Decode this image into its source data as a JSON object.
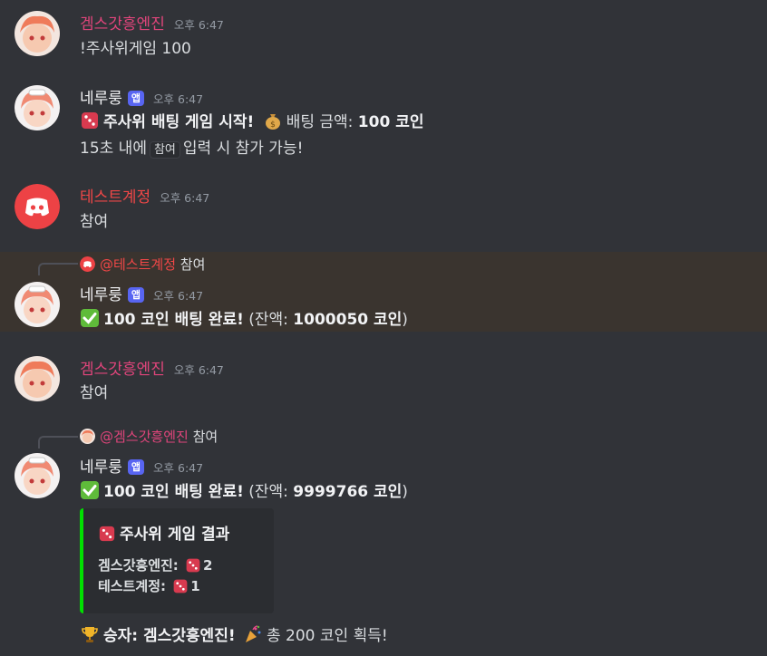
{
  "colors": {
    "background": "#313338",
    "gemsu_name": "#e0457b",
    "test_name": "#f04747",
    "bot_name": "#f2f3f5",
    "app_badge": "#5865f2",
    "embed_bar": "#00e000",
    "highlight": "#3a342f"
  },
  "messages": [
    {
      "author": "겜스갓흥엔진",
      "time": "오후 6:47",
      "text": "!주사위게임 100"
    },
    {
      "author": "네루룽",
      "badge": "앱",
      "time": "오후 6:47",
      "line1_bold": "주사위 배팅 게임 시작!",
      "line1_pre": "배팅 금액: ",
      "line1_amount": "100 코인",
      "line2_a": "15초 내에",
      "line2_code": "참여",
      "line2_b": "입력 시 참가 가능!"
    },
    {
      "author": "테스트계정",
      "time": "오후 6:47",
      "text": "참여"
    },
    {
      "reply_to": "@테스트계정",
      "reply_text": "참여",
      "author": "네루룽",
      "badge": "앱",
      "time": "오후 6:47",
      "bold": "100 코인 배팅 완료!",
      "pre": " (잔액: ",
      "balance": "1000050 코인",
      "post": ")"
    },
    {
      "author": "겜스갓흥엔진",
      "time": "오후 6:47",
      "text": "참여"
    },
    {
      "reply_to": "@겜스갓흥엔진",
      "reply_text": "참여",
      "author": "네루룽",
      "badge": "앱",
      "time": "오후 6:47",
      "bold": "100 코인 배팅 완료!",
      "pre": " (잔액: ",
      "balance": "9999766 코인",
      "post": ")"
    }
  ],
  "embed": {
    "title": "주사위 게임 결과",
    "rows": [
      {
        "name": "겜스갓흥엔진:",
        "value": "2"
      },
      {
        "name": "테스트계정:",
        "value": "1"
      }
    ]
  },
  "result": {
    "bold": "승자: 겜스갓흥엔진!",
    "text": "총 200 코인 획득!"
  },
  "icons": [
    "dice-icon",
    "money-bag-icon",
    "check-icon",
    "trophy-icon",
    "party-popper-icon",
    "discord-logo-icon"
  ]
}
